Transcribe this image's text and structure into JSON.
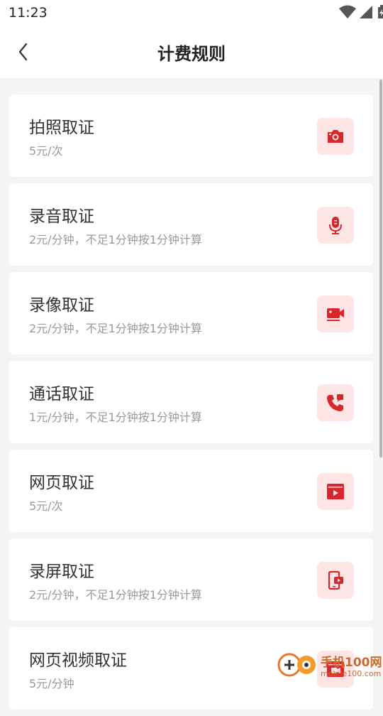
{
  "status_bar": {
    "time": "11:23"
  },
  "header": {
    "title": "计费规则"
  },
  "colors": {
    "accent": "#d9252c",
    "icon_bg": "#fde5e5"
  },
  "items": [
    {
      "name": "拍照取证",
      "price": "5元/次",
      "icon": "camera-icon"
    },
    {
      "name": "录音取证",
      "price": "2元/分钟，不足1分钟按1分钟计算",
      "icon": "microphone-icon"
    },
    {
      "name": "录像取证",
      "price": "2元/分钟，不足1分钟按1分钟计算",
      "icon": "video-camera-icon"
    },
    {
      "name": "通话取证",
      "price": "1元/分钟，不足1分钟按1分钟计算",
      "icon": "phone-call-icon"
    },
    {
      "name": "网页取证",
      "price": "5元/次",
      "icon": "web-page-play-icon"
    },
    {
      "name": "录屏取证",
      "price": "2元/分钟，不足1分钟按1分钟计算",
      "icon": "screen-record-icon"
    },
    {
      "name": "网页视频取证",
      "price": "5元/分钟",
      "icon": "web-video-icon"
    }
  ],
  "watermark": {
    "text": "手机100网",
    "sub": "mobile100.com"
  }
}
